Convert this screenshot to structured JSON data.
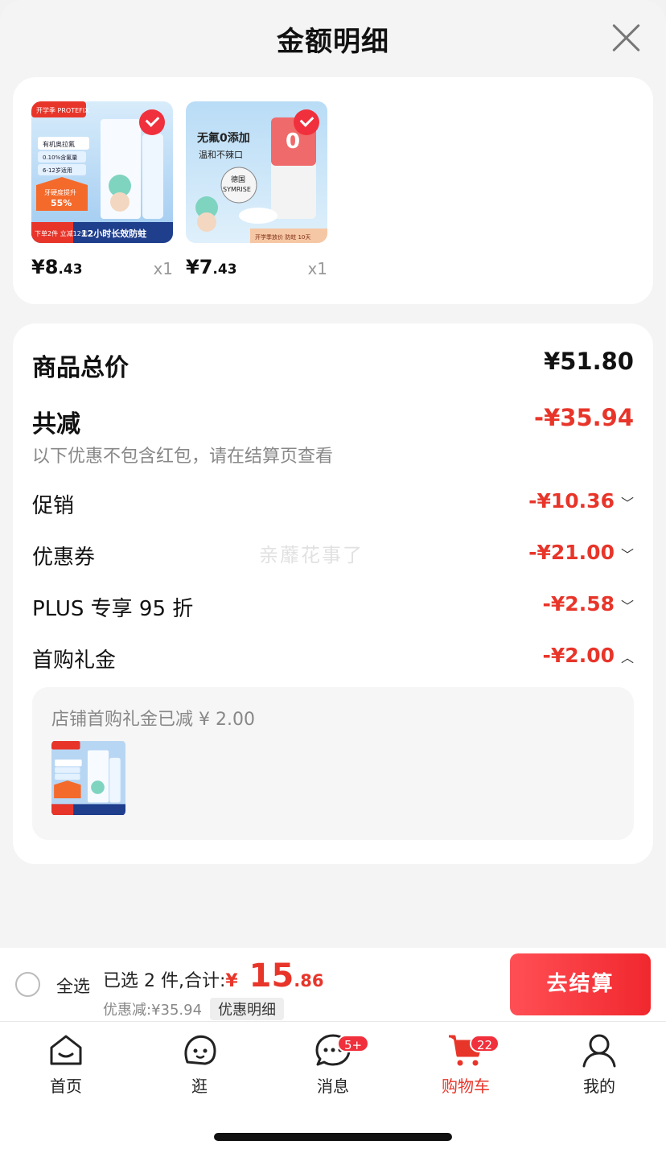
{
  "sheet": {
    "title": "金额明细"
  },
  "products": [
    {
      "price_yen": "¥",
      "price_int": "8",
      "price_dec": ".43",
      "qty": "x1",
      "img": {
        "top_brand": "开学季 PROTEFIX",
        "line1": "有机奥拉氟",
        "line2": "0.10%含氟量",
        "line3": "6-12岁适用",
        "promo1": "牙硬度提升",
        "promo2": "55%",
        "bottom_left": "下单2件 立减12元",
        "bottom": "12小时长效防蛀"
      }
    },
    {
      "price_yen": "¥",
      "price_int": "7",
      "price_dec": ".43",
      "qty": "x1",
      "img": {
        "line1": "无氟0添加",
        "line2": "温和不辣口",
        "badge1": "德国",
        "badge2": "SYMRISE",
        "bottom": "开学季放价 防蛀 10天"
      }
    }
  ],
  "detail": {
    "total_label": "商品总价",
    "total_value": "¥51.80",
    "reduce_label": "共减",
    "reduce_value": "-¥35.94",
    "reduce_note": "以下优惠不包含红包，请在结算页查看",
    "items": [
      {
        "label": "促销",
        "value": "-¥10.36",
        "chevron": "chevron-down"
      },
      {
        "label": "优惠券",
        "value": "-¥21.00",
        "chevron": "chevron-down"
      },
      {
        "label": "PLUS 专享 95 折",
        "value": "-¥2.58",
        "chevron": "chevron-down"
      },
      {
        "label": "首购礼金",
        "value": "-¥2.00",
        "chevron": "chevron-up"
      }
    ],
    "gift_text": "店铺首购礼金已减 ¥ 2.00",
    "watermark": "亲蘼花事了"
  },
  "checkout": {
    "select_all": "全选",
    "summary_prefix": "已选 2 件,合计:",
    "total_yen": "¥",
    "total_int": " 15",
    "total_dec": ".86",
    "discount_text": "优惠减:¥35.94",
    "detail_chip": "优惠明细",
    "pay_label": "去结算"
  },
  "tabs": [
    {
      "label": "首页",
      "icon": "home-icon"
    },
    {
      "label": "逛",
      "icon": "browse-icon"
    },
    {
      "label": "消息",
      "icon": "message-icon",
      "badge": "5+"
    },
    {
      "label": "购物车",
      "icon": "cart-icon",
      "badge": "22",
      "active": true
    },
    {
      "label": "我的",
      "icon": "profile-icon"
    }
  ],
  "colors": {
    "accent": "#e8352a",
    "brand_red": "#f0303c"
  }
}
